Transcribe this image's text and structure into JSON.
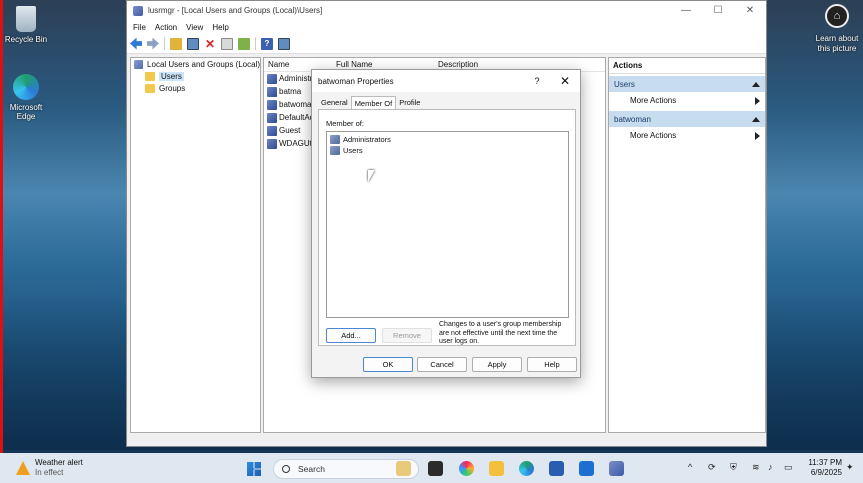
{
  "desktop": {
    "icons": [
      {
        "label": "Recycle Bin",
        "icon": "recycle-bin-icon"
      },
      {
        "label": "Microsoft Edge",
        "icon": "edge-icon"
      }
    ],
    "learn_label": "Learn about this picture"
  },
  "window": {
    "title": "lusrmgr - [Local Users and Groups (Local)\\Users]",
    "controls": {
      "minimize": "—",
      "maximize": "☐",
      "close": "✕"
    },
    "menu": [
      "File",
      "Action",
      "View",
      "Help"
    ]
  },
  "tree": {
    "root": "Local Users and Groups (Local)",
    "children": [
      "Users",
      "Groups"
    ],
    "selected": "Users"
  },
  "list": {
    "columns": [
      "Name",
      "Full Name",
      "Description"
    ],
    "rows": [
      "Administr",
      "batma",
      "batwoma",
      "DefaultAc",
      "Guest",
      "WDAGUti"
    ]
  },
  "actions": {
    "title": "Actions",
    "sections": [
      {
        "label": "Users",
        "item": "More Actions"
      },
      {
        "label": "batwoman",
        "item": "More Actions"
      }
    ]
  },
  "dialog": {
    "title": "batwoman Properties",
    "help": "?",
    "close": "✕",
    "tabs": [
      "General",
      "Member Of",
      "Profile"
    ],
    "active_tab": "Member Of",
    "member_of_label": "Member of:",
    "groups": [
      "Administrators",
      "Users"
    ],
    "add_label": "Add...",
    "remove_label": "Remove",
    "note": "Changes to a user's group membership are not effective until the next time the user logs on.",
    "ok_label": "OK",
    "cancel_label": "Cancel",
    "apply_label": "Apply",
    "help_label": "Help"
  },
  "taskbar": {
    "weather_title": "Weather alert",
    "weather_sub": "In effect",
    "search_placeholder": "Search",
    "time": "11:37 PM",
    "date": "6/9/2025"
  }
}
